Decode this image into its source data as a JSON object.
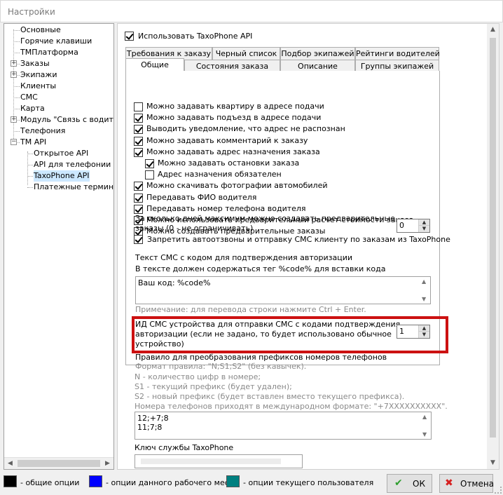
{
  "window": {
    "title": "Настройки"
  },
  "tree": {
    "items": [
      {
        "label": "Основные",
        "expandable": false,
        "depth": 0
      },
      {
        "label": "Горячие клавиши",
        "expandable": false,
        "depth": 0
      },
      {
        "label": "ТМПлатформа",
        "expandable": false,
        "depth": 0
      },
      {
        "label": "Заказы",
        "expandable": true,
        "depth": 0
      },
      {
        "label": "Экипажи",
        "expandable": true,
        "depth": 0
      },
      {
        "label": "Клиенты",
        "expandable": false,
        "depth": 0
      },
      {
        "label": "СМС",
        "expandable": false,
        "depth": 0
      },
      {
        "label": "Карта",
        "expandable": false,
        "depth": 0
      },
      {
        "label": "Модуль \"Связь с водителя",
        "expandable": true,
        "depth": 0
      },
      {
        "label": "Телефония",
        "expandable": false,
        "depth": 0
      },
      {
        "label": "ТМ API",
        "expandable": true,
        "expanded": true,
        "depth": 0
      },
      {
        "label": "Открытое API",
        "expandable": false,
        "depth": 1
      },
      {
        "label": "API для телефонии",
        "expandable": false,
        "depth": 1
      },
      {
        "label": "TaxoPhone API",
        "expandable": false,
        "depth": 1,
        "selected": true
      },
      {
        "label": "Платежные терминалы",
        "expandable": false,
        "depth": 1
      }
    ]
  },
  "main": {
    "use_api": {
      "label": "Использовать TaxoPhone API",
      "checked": true
    },
    "tabs_row1": [
      "Требования к заказу",
      "Черный список",
      "Подбор экипажей",
      "Рейтинги водителей"
    ],
    "tabs_row2": [
      "Общие",
      "Состояния заказа",
      "Описание",
      "Группы экипажей"
    ],
    "active_tab": "Общие",
    "options": [
      {
        "label": "Можно задавать квартиру в адресе подачи",
        "checked": false
      },
      {
        "label": "Можно задавать подъезд в адресе подачи",
        "checked": true
      },
      {
        "label": "Выводить уведомление, что адрес не распознан",
        "checked": true
      },
      {
        "label": "Можно задавать комментарий к заказу",
        "checked": true
      },
      {
        "label": "Можно задавать адрес назначения заказа",
        "checked": true
      },
      {
        "label": "Можно задавать остановки заказа",
        "checked": true,
        "indent": true
      },
      {
        "label": "Адрес назначения обязателен",
        "checked": false,
        "indent": true
      },
      {
        "label": "Можно скачивать фотографии автомобилей",
        "checked": true
      },
      {
        "label": "Передавать ФИО водителя",
        "checked": true
      },
      {
        "label": "Передавать номер телефона водителя",
        "checked": true
      },
      {
        "label": "Можно использовать предварительный расчет стоимости заказа",
        "checked": true
      },
      {
        "label": "Можно создавать предварительные заказы",
        "checked": true
      }
    ],
    "prelim_days": {
      "label_line1": "За сколько дней максимум можно создавать предварительные",
      "label_line2": "заказы (0 - не ограничивать)",
      "value": "0"
    },
    "block_autocalls": {
      "label": "Запретить автоотзвоны и отправку СМС клиенту по заказам из TaxoPhone",
      "checked": true
    },
    "sms_text": {
      "title": "Текст СМС с кодом для подтверждения авторизации",
      "hint": "В тексте должен содержаться тег %code% для вставки кода",
      "value": "Ваш код: %code%",
      "note": "Примечание: для перевода строки нажмите Ctrl + Enter."
    },
    "sms_device": {
      "line1": "ИД СМС устройства для отправки СМС с кодами подтверждения",
      "line2": "авторизации (если не задано, то будет использовано обычное",
      "line3": "устройство)",
      "value": "1"
    },
    "prefix_rule": {
      "title": "Правило для преобразования префиксов номеров телефонов",
      "lines": [
        "Формат правила: \"N;S1;S2\" (без кавычек).",
        "N - количество цифр в номере;",
        "S1 - текущий префикс (будет удален);",
        "S2 - новый префикс (будет вставлен вместо текущего префикса).",
        "Номера телефонов приходят в международном формате: \"+7XXXXXXXXXX\"."
      ],
      "memo_lines": [
        "12;+7;8",
        "11;7;8"
      ]
    },
    "service_key": {
      "label": "Ключ службы TaxoPhone",
      "value": ""
    }
  },
  "legend": {
    "items": [
      {
        "label": "- общие опции",
        "color": "#000000"
      },
      {
        "label": "- опции данного рабочего места",
        "color": "#0000ff"
      },
      {
        "label": "- опции текущего пользователя",
        "color": "#008080"
      }
    ]
  },
  "buttons": {
    "ok": "ОК",
    "cancel": "Отмена"
  },
  "colors": {
    "highlight": "#cc1111",
    "ok_check": "#2e9e2e",
    "cancel_x": "#d62020"
  }
}
